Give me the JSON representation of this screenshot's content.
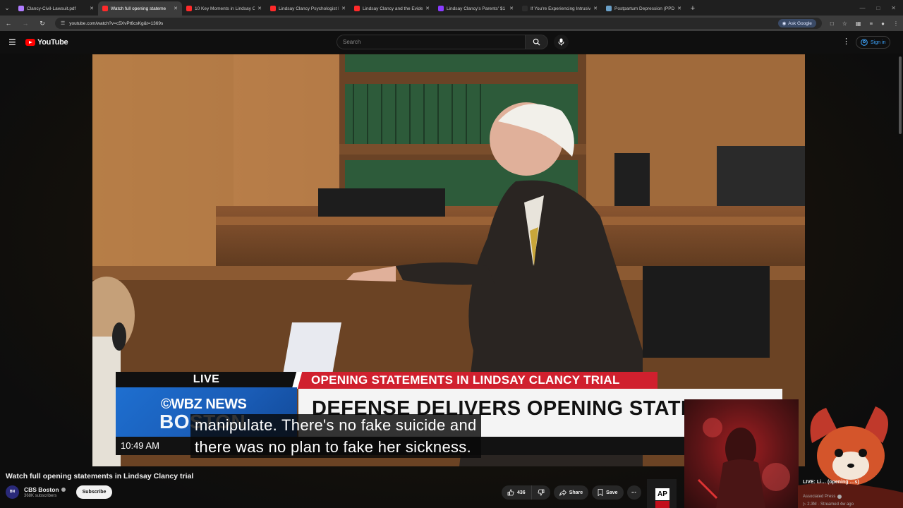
{
  "browser": {
    "tabs": [
      {
        "label": "Clancy-Civil-Lawsuit.pdf",
        "fav_color": "#b07cff",
        "active": false
      },
      {
        "label": "Watch full opening stateme",
        "fav_color": "#ff2a2a",
        "active": true
      },
      {
        "label": "10 Key Moments in Lindsay Cla",
        "fav_color": "#ff2a2a",
        "active": false
      },
      {
        "label": "Lindsay Clancy Psychologist De",
        "fav_color": "#ff2a2a",
        "active": false
      },
      {
        "label": "Lindsay Clancy and the Eviden",
        "fav_color": "#ff2a2a",
        "active": false
      },
      {
        "label": "Lindsay Clancy's Parents' $1 Mi",
        "fav_color": "#8a3cff",
        "active": false
      },
      {
        "label": "If You're Experiencing Intrusive",
        "fav_color": "#2c2c2c",
        "active": false
      },
      {
        "label": "Postpartum Depression (PPD)",
        "fav_color": "#6aa0c8",
        "active": false
      }
    ],
    "url": "youtube.com/watch?v=c5XvPt6csKg&t=1369s",
    "ask_google": "Ask Google"
  },
  "header": {
    "logo_text": "YouTube",
    "search_placeholder": "Search",
    "sign_in": "Sign in"
  },
  "video": {
    "live_tag": "LIVE",
    "red_banner": "OPENING STATEMENTS IN LINDSAY CLANCY TRIAL",
    "brand_name": "©WBZ NEWS",
    "brand_city": "BOSTON",
    "headline": "DEFENSE DELIVERS OPENING STATEMEN",
    "time": "10:49 AM",
    "caption_line1": "manipulate. There's no fake suicide and",
    "caption_line2": "there was no plan to fake her sickness."
  },
  "info": {
    "title": "Watch full opening statements in Lindsay Clancy trial",
    "channel_name": "CBS Boston",
    "subscribers": "368K subscribers",
    "subscribe": "Subscribe",
    "avatar_text": "BN",
    "likes": "436",
    "share": "Share",
    "save": "Save"
  },
  "recommendation": {
    "title": "LIVE: Li… (opening …s)",
    "channel": "Associated Press",
    "stats": "▷ 2.3M · Streamed 4w ago",
    "thumb_logo": "AP"
  }
}
